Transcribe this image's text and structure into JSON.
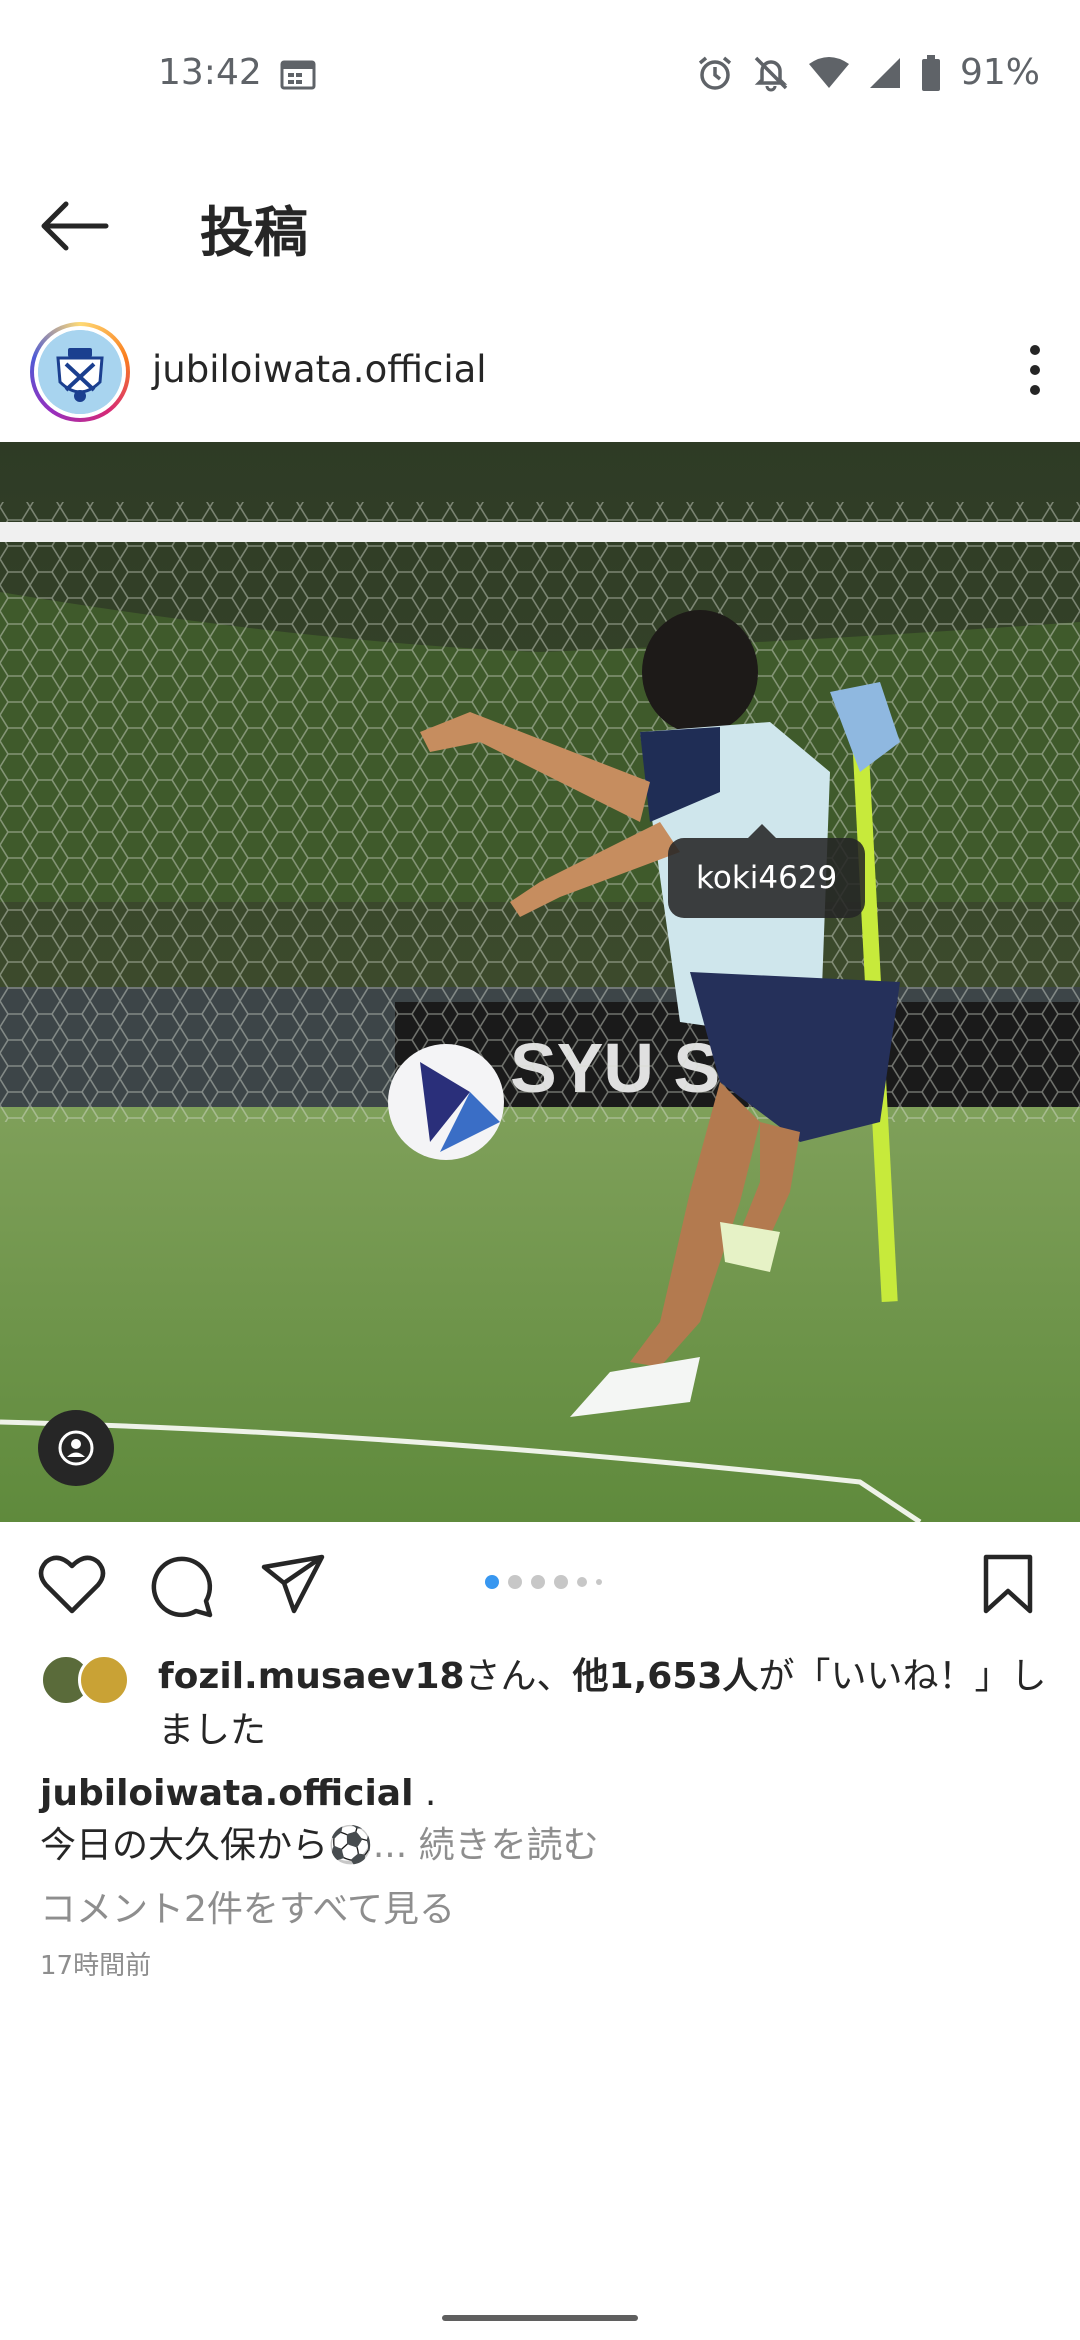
{
  "status_bar": {
    "time": "13:42",
    "battery": "91%",
    "icons": [
      "calendar-icon",
      "alarm-icon",
      "bell-off-icon",
      "wifi-icon",
      "signal-icon",
      "battery-icon"
    ]
  },
  "header": {
    "title": "投稿",
    "back_icon": "arrow-left-icon"
  },
  "post": {
    "username": "jubiloiwata.official",
    "more_icon": "more-vertical-icon",
    "image": {
      "tag_label": "koki4629",
      "carousel": {
        "total": 6,
        "active": 1
      }
    },
    "likes": {
      "user": "fozil.musaev18",
      "mid": "さん、",
      "others": "他1,653人",
      "tail": "が「いいね！」しました"
    },
    "caption": {
      "user": "jubiloiwata.official",
      "after_user": " .",
      "text": "今日の大久保から⚽️",
      "more": "... 続きを読む"
    },
    "view_comments": "コメント2件をすべて見る",
    "timestamp": "17時間前"
  },
  "colors": {
    "accent": "#3897f0",
    "text": "#262626",
    "muted": "#8e8e8e"
  }
}
